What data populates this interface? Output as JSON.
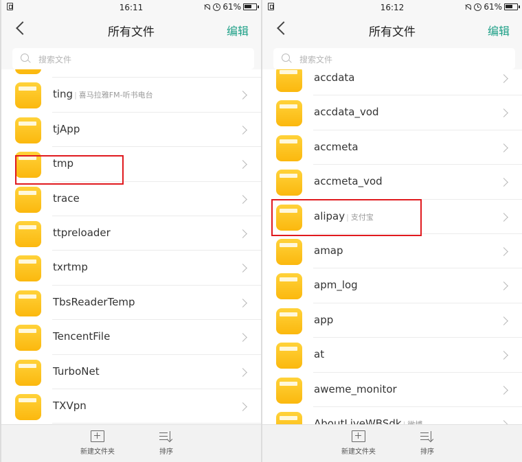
{
  "colors": {
    "accent": "#1ea087",
    "folder": "#fbb80e",
    "highlight": "#e0191e"
  },
  "left": {
    "status": {
      "time": "16:11",
      "battery": "61%"
    },
    "header": {
      "title": "所有文件",
      "edit_label": "编辑"
    },
    "search": {
      "placeholder": "搜索文件"
    },
    "folders": [
      {
        "name": "",
        "sub": ""
      },
      {
        "name": "ting",
        "sub": "喜马拉雅FM-听书电台"
      },
      {
        "name": "tjApp",
        "sub": ""
      },
      {
        "name": "tmp",
        "sub": ""
      },
      {
        "name": "trace",
        "sub": ""
      },
      {
        "name": "ttpreloader",
        "sub": ""
      },
      {
        "name": "txrtmp",
        "sub": ""
      },
      {
        "name": "TbsReaderTemp",
        "sub": ""
      },
      {
        "name": "TencentFile",
        "sub": ""
      },
      {
        "name": "TurboNet",
        "sub": ""
      },
      {
        "name": "TXVpn",
        "sub": ""
      }
    ],
    "bottom": {
      "new_folder_label": "新建文件夹",
      "sort_label": "排序"
    }
  },
  "right": {
    "status": {
      "time": "16:12",
      "battery": "61%"
    },
    "header": {
      "title": "所有文件",
      "edit_label": "编辑"
    },
    "search": {
      "placeholder": "搜索文件"
    },
    "folders": [
      {
        "name": "accdata",
        "sub": ""
      },
      {
        "name": "accdata_vod",
        "sub": ""
      },
      {
        "name": "accmeta",
        "sub": ""
      },
      {
        "name": "accmeta_vod",
        "sub": ""
      },
      {
        "name": "alipay",
        "sub": "支付宝"
      },
      {
        "name": "amap",
        "sub": ""
      },
      {
        "name": "apm_log",
        "sub": ""
      },
      {
        "name": "app",
        "sub": ""
      },
      {
        "name": "at",
        "sub": ""
      },
      {
        "name": "aweme_monitor",
        "sub": ""
      },
      {
        "name": "AboutLiveWBSdk",
        "sub": "微博"
      }
    ],
    "bottom": {
      "new_folder_label": "新建文件夹",
      "sort_label": "排序"
    }
  }
}
